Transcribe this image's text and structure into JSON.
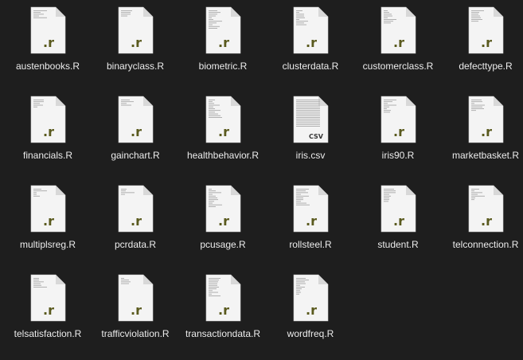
{
  "files": [
    {
      "name": "austenbooks.R",
      "badge": ".r",
      "icon": "r-script-file-icon"
    },
    {
      "name": "binaryclass.R",
      "badge": ".r",
      "icon": "r-script-file-icon"
    },
    {
      "name": "biometric.R",
      "badge": ".r",
      "icon": "r-script-file-icon"
    },
    {
      "name": "clusterdata.R",
      "badge": ".r",
      "icon": "r-script-file-icon"
    },
    {
      "name": "customerclass.R",
      "badge": ".r",
      "icon": "r-script-file-icon"
    },
    {
      "name": "defecttype.R",
      "badge": ".r",
      "icon": "r-script-file-icon"
    },
    {
      "name": "financials.R",
      "badge": ".r",
      "icon": "r-script-file-icon"
    },
    {
      "name": "gainchart.R",
      "badge": ".r",
      "icon": "r-script-file-icon"
    },
    {
      "name": "healthbehavior.R",
      "badge": ".r",
      "icon": "r-script-file-icon"
    },
    {
      "name": "iris.csv",
      "badge": "CSV",
      "icon": "csv-file-icon"
    },
    {
      "name": "iris90.R",
      "badge": ".r",
      "icon": "r-script-file-icon"
    },
    {
      "name": "marketbasket.R",
      "badge": ".r",
      "icon": "r-script-file-icon"
    },
    {
      "name": "multiplsreg.R",
      "badge": ".r",
      "icon": "r-script-file-icon"
    },
    {
      "name": "pcrdata.R",
      "badge": ".r",
      "icon": "r-script-file-icon"
    },
    {
      "name": "pcusage.R",
      "badge": ".r",
      "icon": "r-script-file-icon"
    },
    {
      "name": "rollsteel.R",
      "badge": ".r",
      "icon": "r-script-file-icon"
    },
    {
      "name": "student.R",
      "badge": ".r",
      "icon": "r-script-file-icon"
    },
    {
      "name": "telconnection.R",
      "badge": ".r",
      "icon": "r-script-file-icon"
    },
    {
      "name": "telsatisfaction.R",
      "badge": ".r",
      "icon": "r-script-file-icon"
    },
    {
      "name": "trafficviolation.R",
      "badge": ".r",
      "icon": "r-script-file-icon"
    },
    {
      "name": "transactiondata.R",
      "badge": ".r",
      "icon": "r-script-file-icon"
    },
    {
      "name": "wordfreq.R",
      "badge": ".r",
      "icon": "r-script-file-icon"
    }
  ],
  "colors": {
    "background": "#1e1e1e",
    "label_text": "#ececec",
    "page": "#f4f4f4",
    "fold": "#d8d8d8",
    "r_badge": "#5a5a1e"
  }
}
